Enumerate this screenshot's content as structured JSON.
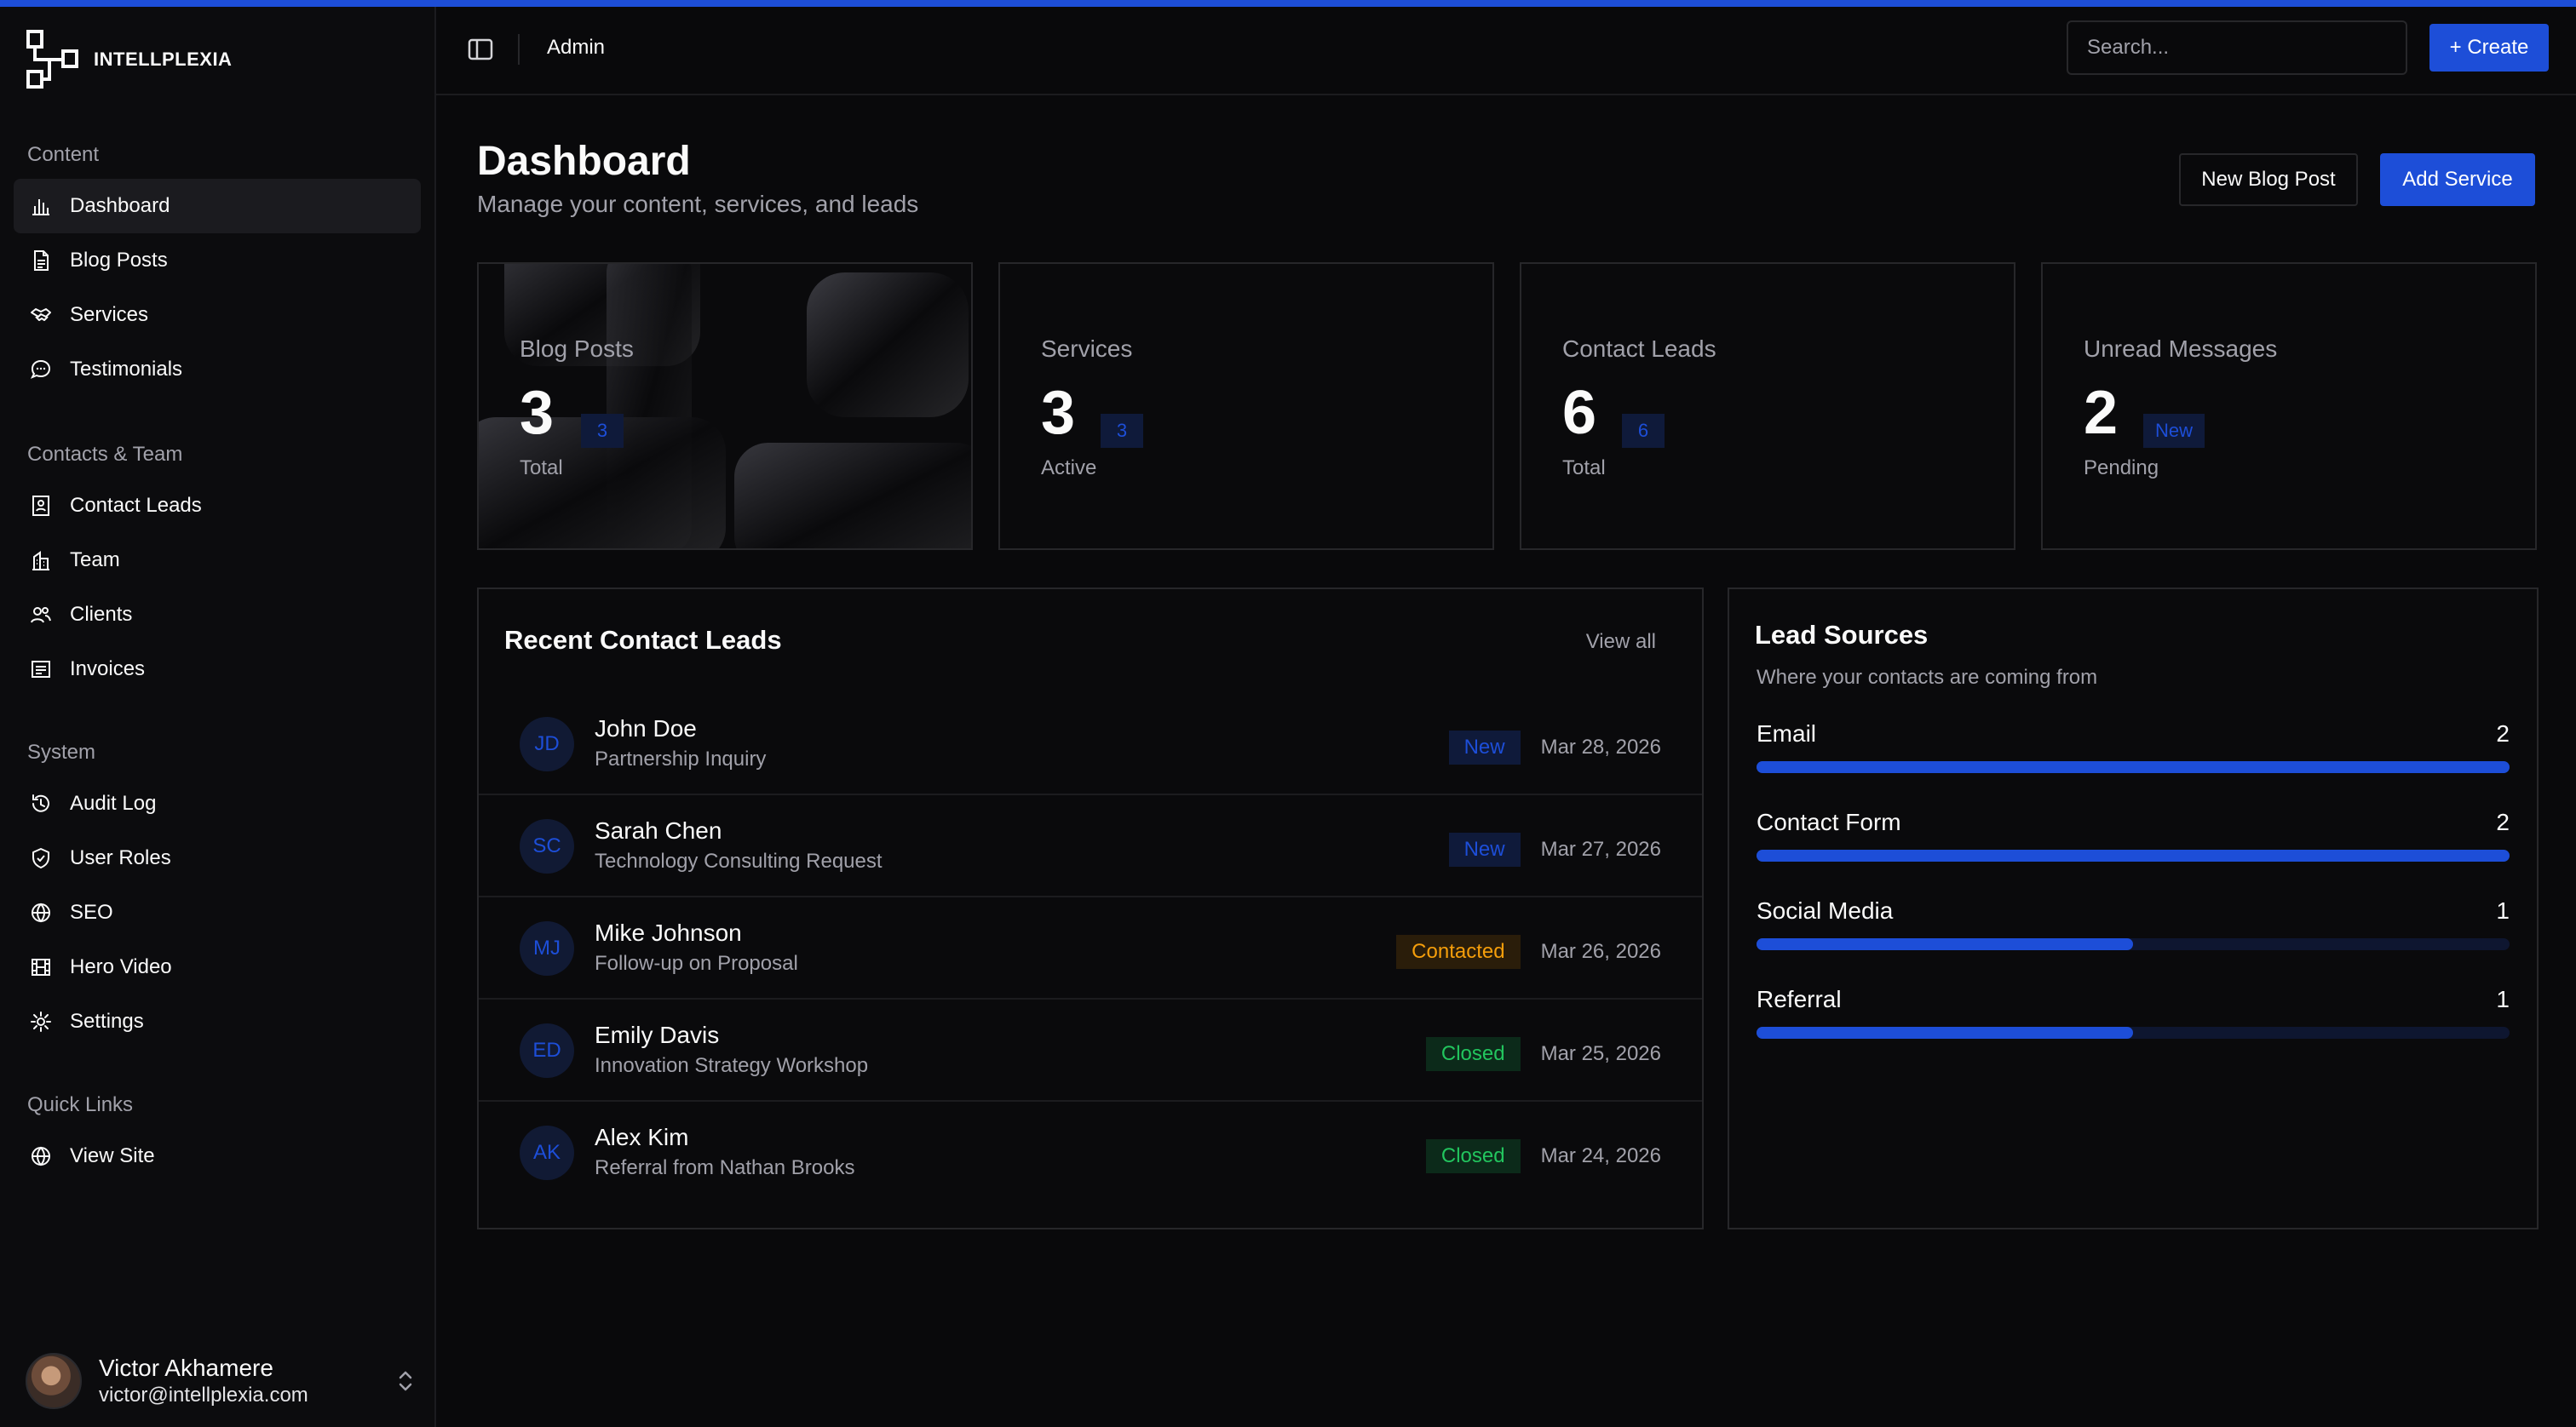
{
  "brand": {
    "name": "INTELLPLEXIA"
  },
  "sidebar": {
    "groups": [
      {
        "label": "Content",
        "items": [
          {
            "label": "Dashboard",
            "icon": "chart-bar-icon",
            "active": true
          },
          {
            "label": "Blog Posts",
            "icon": "document-icon"
          },
          {
            "label": "Services",
            "icon": "handshake-icon"
          },
          {
            "label": "Testimonials",
            "icon": "message-icon"
          }
        ]
      },
      {
        "label": "Contacts & Team",
        "items": [
          {
            "label": "Contact Leads",
            "icon": "contact-book-icon"
          },
          {
            "label": "Team",
            "icon": "building-icon"
          },
          {
            "label": "Clients",
            "icon": "users-icon"
          },
          {
            "label": "Invoices",
            "icon": "receipt-icon"
          }
        ]
      },
      {
        "label": "System",
        "items": [
          {
            "label": "Audit Log",
            "icon": "history-icon"
          },
          {
            "label": "User Roles",
            "icon": "shield-icon"
          },
          {
            "label": "SEO",
            "icon": "globe-icon"
          },
          {
            "label": "Hero Video",
            "icon": "film-icon"
          },
          {
            "label": "Settings",
            "icon": "gear-icon"
          }
        ]
      },
      {
        "label": "Quick Links",
        "items": [
          {
            "label": "View Site",
            "icon": "globe-icon"
          }
        ]
      }
    ],
    "user": {
      "name": "Victor Akhamere",
      "email": "victor@intellplexia.com"
    }
  },
  "header": {
    "breadcrumb": "Admin",
    "search_placeholder": "Search...",
    "create_label": "+ Create"
  },
  "main": {
    "title": "Dashboard",
    "subtitle": "Manage your content, services, and leads",
    "new_blog_label": "New Blog Post",
    "add_service_label": "Add Service",
    "stats": [
      {
        "label": "Blog Posts",
        "value": "3",
        "badge": "3",
        "caption": "Total"
      },
      {
        "label": "Services",
        "value": "3",
        "badge": "3",
        "caption": "Active"
      },
      {
        "label": "Contact Leads",
        "value": "6",
        "badge": "6",
        "caption": "Total"
      },
      {
        "label": "Unread Messages",
        "value": "2",
        "badge": "New",
        "caption": "Pending"
      }
    ]
  },
  "leads": {
    "title": "Recent Contact Leads",
    "view_all": "View all",
    "rows": [
      {
        "initials": "JD",
        "name": "John Doe",
        "subject": "Partnership Inquiry",
        "status": "New",
        "date": "Mar 28, 2026"
      },
      {
        "initials": "SC",
        "name": "Sarah Chen",
        "subject": "Technology Consulting Request",
        "status": "New",
        "date": "Mar 27, 2026"
      },
      {
        "initials": "MJ",
        "name": "Mike Johnson",
        "subject": "Follow-up on Proposal",
        "status": "Contacted",
        "date": "Mar 26, 2026"
      },
      {
        "initials": "ED",
        "name": "Emily Davis",
        "subject": "Innovation Strategy Workshop",
        "status": "Closed",
        "date": "Mar 25, 2026"
      },
      {
        "initials": "AK",
        "name": "Alex Kim",
        "subject": "Referral from Nathan Brooks",
        "status": "Closed",
        "date": "Mar 24, 2026"
      }
    ]
  },
  "sources": {
    "title": "Lead Sources",
    "subtitle": "Where your contacts are coming from",
    "rows": [
      {
        "label": "Email",
        "count": "2",
        "fraction": 1.0
      },
      {
        "label": "Contact Form",
        "count": "2",
        "fraction": 1.0
      },
      {
        "label": "Social Media",
        "count": "1",
        "fraction": 0.5
      },
      {
        "label": "Referral",
        "count": "1",
        "fraction": 0.5
      }
    ]
  },
  "colors": {
    "accent": "#1d4ed8",
    "background": "#09090b",
    "contacted": "#f59e0b",
    "closed": "#22c55e"
  }
}
